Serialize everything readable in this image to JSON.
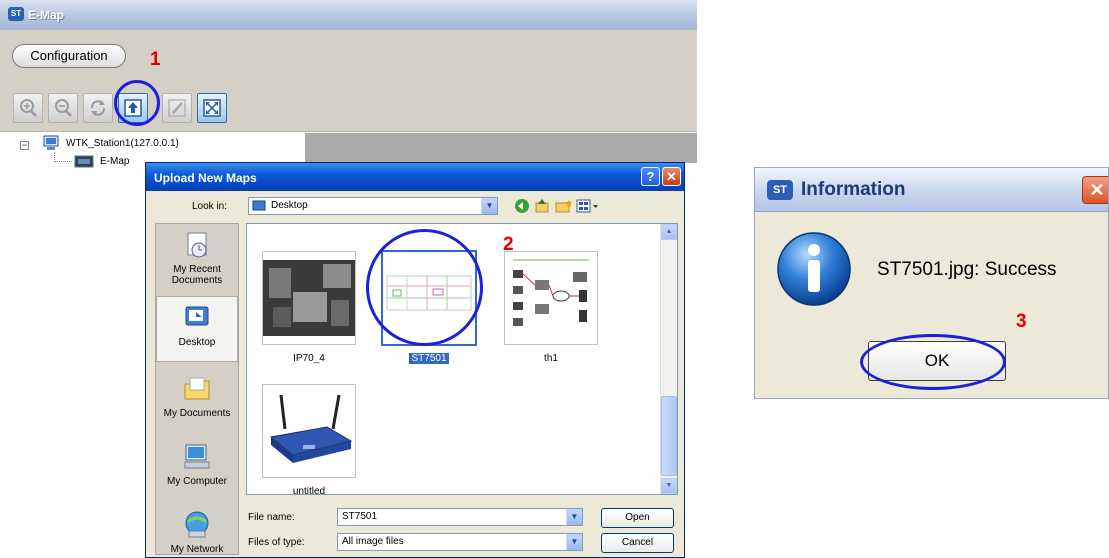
{
  "emap": {
    "title": "E-Map",
    "config_button": "Configuration",
    "toolbar_icons": [
      "zoom-in-icon",
      "zoom-out-icon",
      "refresh-icon",
      "upload-map-icon",
      "edit-icon",
      "fit-to-window-icon"
    ],
    "tree": {
      "station": "WTK_Station1(127.0.0.1)",
      "child": "E-Map"
    }
  },
  "upload_dialog": {
    "title": "Upload New Maps",
    "help": "?",
    "close": "✕",
    "look_in_label": "Look in:",
    "look_in_value": "Desktop",
    "places": [
      {
        "label": "My Recent Documents",
        "icon": "recent-documents-icon"
      },
      {
        "label": "Desktop",
        "icon": "desktop-icon"
      },
      {
        "label": "My Documents",
        "icon": "my-documents-icon"
      },
      {
        "label": "My Computer",
        "icon": "my-computer-icon"
      },
      {
        "label": "My Network",
        "icon": "my-network-icon"
      }
    ],
    "files": [
      "IP70_4",
      "ST7501",
      "th1",
      "untitled"
    ],
    "selected_file": "ST7501",
    "file_name_label": "File name:",
    "file_name_value": "ST7501",
    "file_type_label": "Files of type:",
    "file_type_value": "All image files",
    "open_button": "Open",
    "cancel_button": "Cancel"
  },
  "info_dialog": {
    "title": "Information",
    "close": "✕",
    "message": "ST7501.jpg: Success",
    "ok_button": "OK"
  },
  "annotations": {
    "step1": "1",
    "step2": "2",
    "step3": "3",
    "color": "#e60000",
    "ring_color": "#1d1fe0"
  },
  "brand_logo": "ST"
}
